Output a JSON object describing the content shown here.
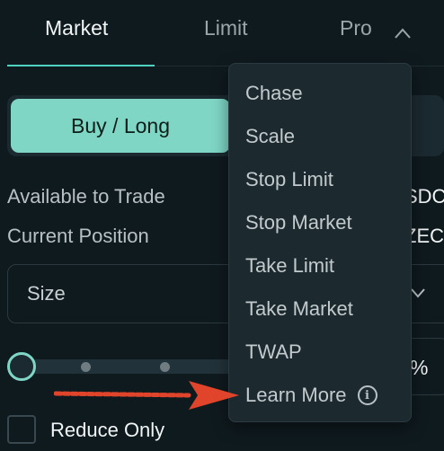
{
  "tabs": [
    {
      "label": "Market",
      "active": true
    },
    {
      "label": "Limit",
      "active": false
    },
    {
      "label": "Pro",
      "active": false
    }
  ],
  "side_toggle": {
    "buy_label": "Buy / Long"
  },
  "info": {
    "available_label": "Available to Trade",
    "available_value": "SDC",
    "position_label": "Current Position",
    "position_value": "ZEC"
  },
  "size_input": {
    "label": "Size"
  },
  "slider": {
    "percent_symbol": "%"
  },
  "reduce_only": {
    "label": "Reduce Only",
    "checked": false
  },
  "pro_menu": {
    "items": [
      "Chase",
      "Scale",
      "Stop Limit",
      "Stop Market",
      "Take Limit",
      "Take Market",
      "TWAP"
    ],
    "learn_more": "Learn More"
  },
  "colors": {
    "background": "#0f1a1f",
    "accent": "#50d2c1",
    "buy_button": "#7fd6c5",
    "annotation_arrow": "#e0452b"
  }
}
